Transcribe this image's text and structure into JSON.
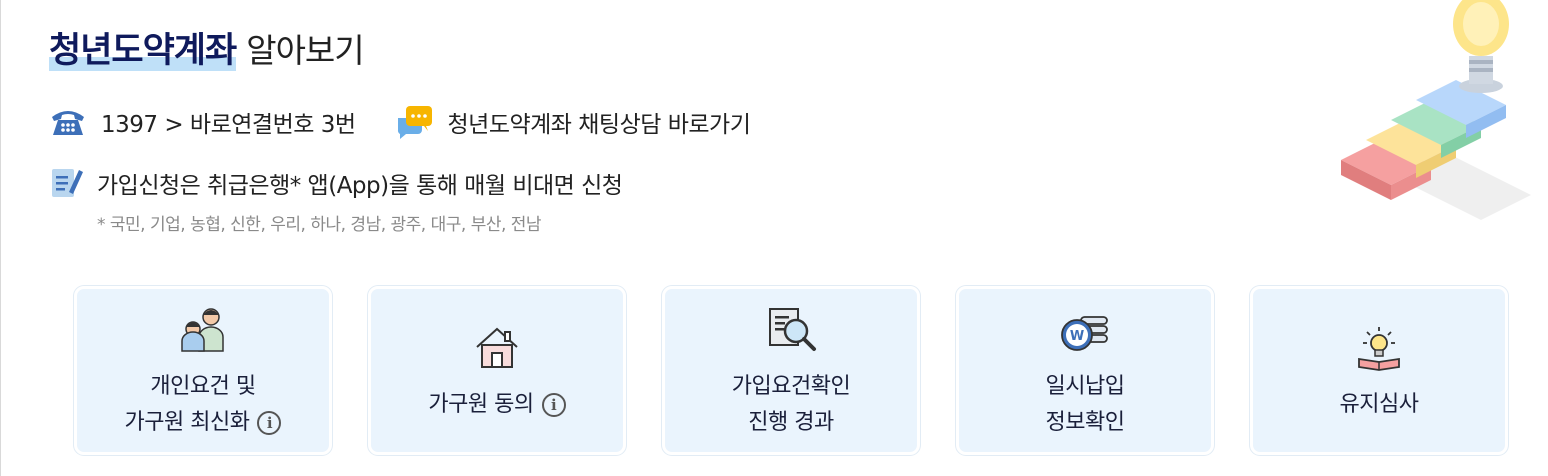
{
  "header": {
    "title_strong": "청년도약계좌",
    "title_normal": "알아보기"
  },
  "contact": {
    "phone_text": "1397 > 바로연결번호 3번",
    "chat_text": "청년도약계좌 채팅상담 바로가기"
  },
  "apply": {
    "text": "가입신청은 취급은행* 앱(App)을 통해 매월 비대면 신청",
    "note": "* 국민, 기업, 농협, 신한, 우리, 하나, 경남, 광주, 대구, 부산, 전남"
  },
  "cards": [
    {
      "line1": "개인요건 및",
      "line2": "가구원 최신화",
      "icon": "family-icon",
      "info": "i"
    },
    {
      "line1": "가구원 동의",
      "line2": "",
      "icon": "house-icon",
      "info": "i"
    },
    {
      "line1": "가입요건확인",
      "line2": "진행 경과",
      "icon": "document-search-icon"
    },
    {
      "line1": "일시납입",
      "line2": "정보확인",
      "icon": "coin-stack-icon"
    },
    {
      "line1": "유지심사",
      "line2": "",
      "icon": "idea-book-icon"
    }
  ],
  "colors": {
    "title": "#0f1a5c",
    "highlight": "#bfe0f8",
    "card_bg": "#eaf4fd",
    "phone_icon": "#3d6fb8",
    "chat_icon": "#f7b500"
  }
}
